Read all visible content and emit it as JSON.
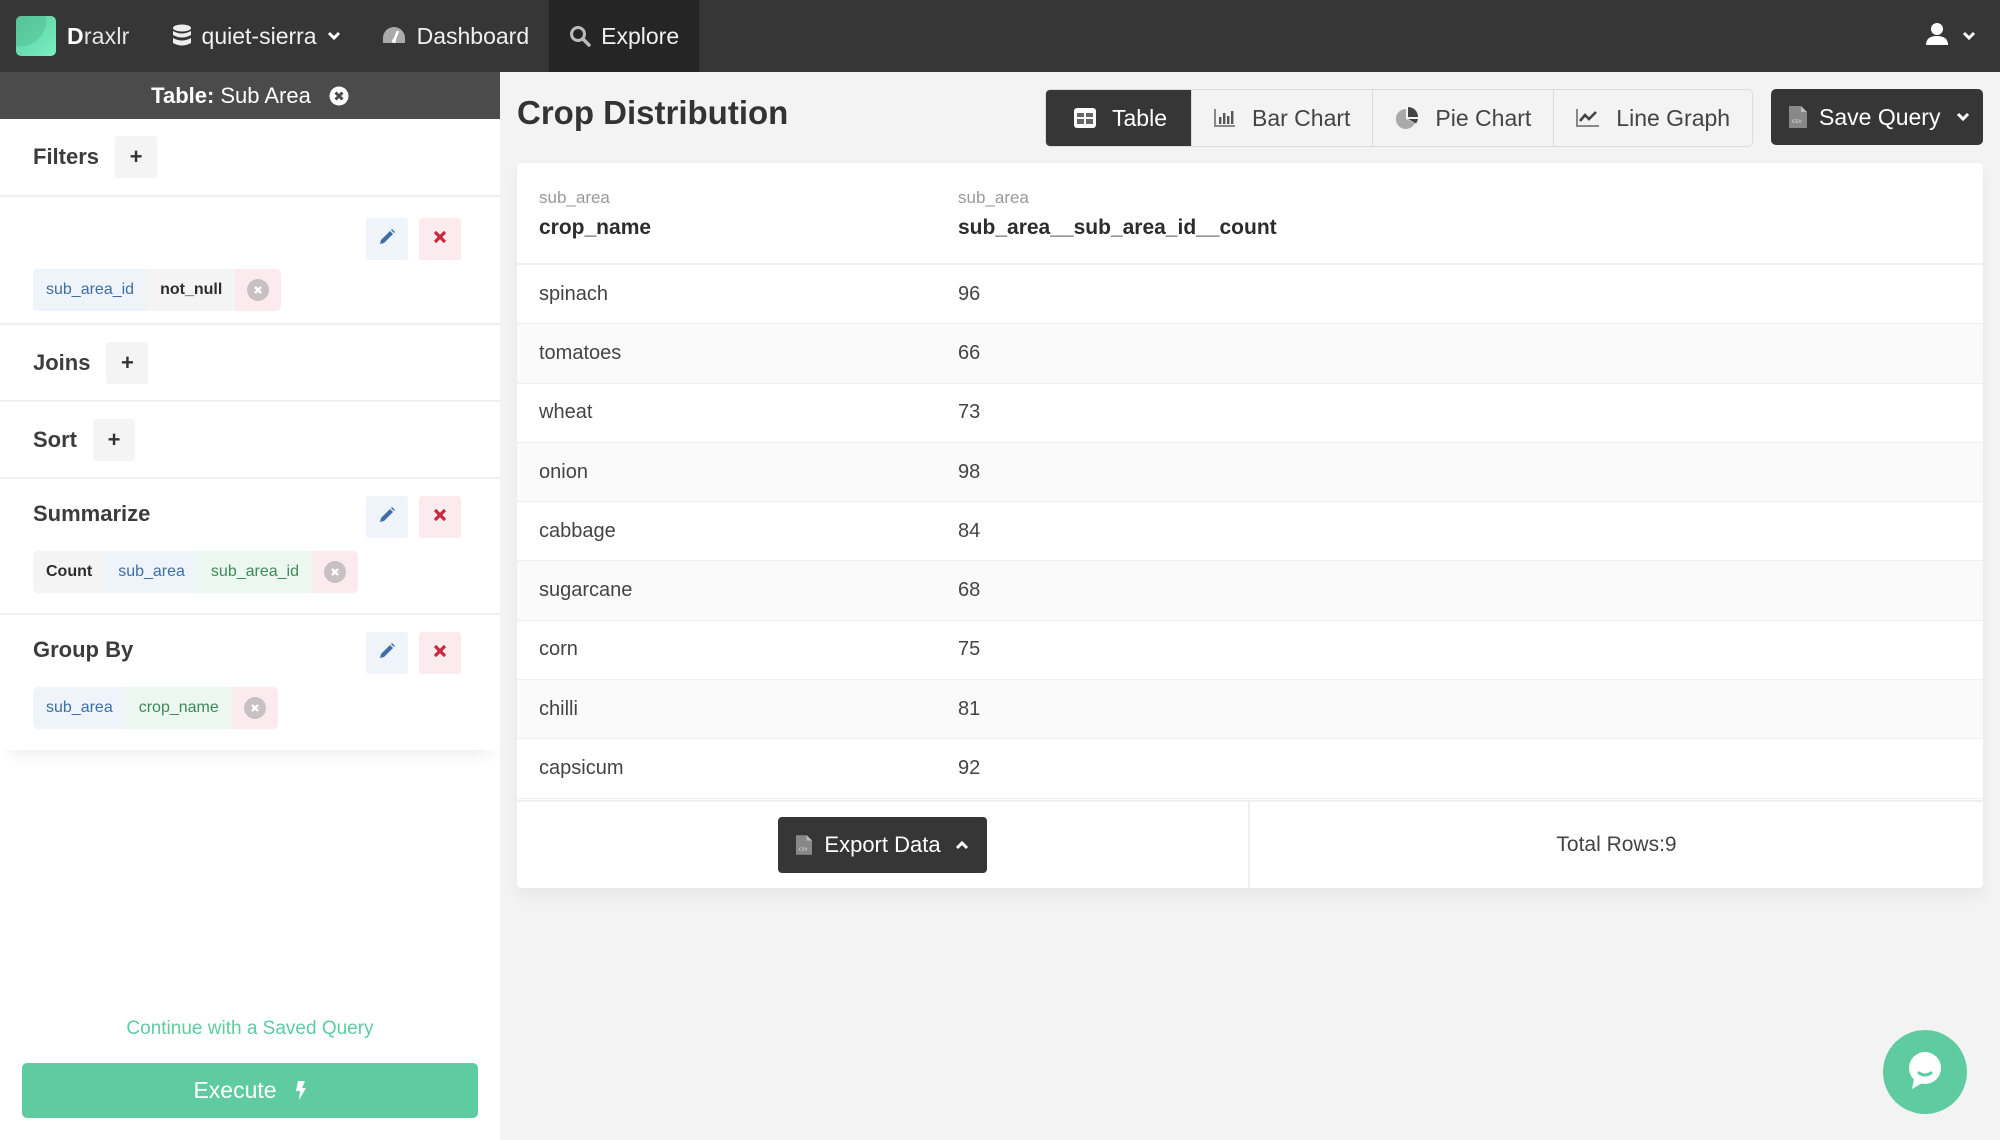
{
  "navbar": {
    "brand": {
      "initial": "D",
      "rest": "raxlr"
    },
    "database": {
      "label": "quiet-sierra",
      "icon": "database-icon"
    },
    "items": [
      {
        "label": "Dashboard",
        "icon": "dashboard-gauge-icon",
        "active": false
      },
      {
        "label": "Explore",
        "icon": "search-icon",
        "active": true
      }
    ],
    "user_icon": "user-icon"
  },
  "sidebar": {
    "table_bar": {
      "prefix": "Table:",
      "name": "Sub Area"
    },
    "filters": {
      "title": "Filters",
      "add_label": "+",
      "chips": [
        {
          "text": "sub_area_id",
          "style": "blue"
        },
        {
          "text": "not_null",
          "style": "gray"
        }
      ]
    },
    "joins": {
      "title": "Joins",
      "add_label": "+"
    },
    "sort": {
      "title": "Sort",
      "add_label": "+"
    },
    "summarize": {
      "title": "Summarize",
      "chips": [
        {
          "text": "Count",
          "style": "gray"
        },
        {
          "text": "sub_area",
          "style": "blue"
        },
        {
          "text": "sub_area_id",
          "style": "green"
        }
      ]
    },
    "group_by": {
      "title": "Group By",
      "chips": [
        {
          "text": "sub_area",
          "style": "blue"
        },
        {
          "text": "crop_name",
          "style": "green"
        }
      ]
    },
    "saved_query_link": "Continue with a Saved Query",
    "execute_label": "Execute"
  },
  "main": {
    "title": "Crop Distribution",
    "view_tabs": [
      {
        "label": "Table",
        "icon": "table-icon",
        "active": true
      },
      {
        "label": "Bar Chart",
        "icon": "bar-chart-icon",
        "active": false
      },
      {
        "label": "Pie Chart",
        "icon": "pie-chart-icon",
        "active": false
      },
      {
        "label": "Line Graph",
        "icon": "line-graph-icon",
        "active": false
      }
    ],
    "save_query_label": "Save Query",
    "table": {
      "columns": [
        {
          "table": "sub_area",
          "name": "crop_name"
        },
        {
          "table": "sub_area",
          "name": "sub_area__sub_area_id__count"
        }
      ],
      "rows": [
        [
          "spinach",
          "96"
        ],
        [
          "tomatoes",
          "66"
        ],
        [
          "wheat",
          "73"
        ],
        [
          "onion",
          "98"
        ],
        [
          "cabbage",
          "84"
        ],
        [
          "sugarcane",
          "68"
        ],
        [
          "corn",
          "75"
        ],
        [
          "chilli",
          "81"
        ],
        [
          "capsicum",
          "92"
        ]
      ]
    },
    "export_label": "Export Data",
    "total_rows_label": "Total Rows:9"
  },
  "colors": {
    "accent": "#5ecca0",
    "navbar": "#363636",
    "chip_blue_text": "#3d6fa5",
    "chip_green_text": "#3d8a57",
    "delete_red": "#c8283c"
  }
}
